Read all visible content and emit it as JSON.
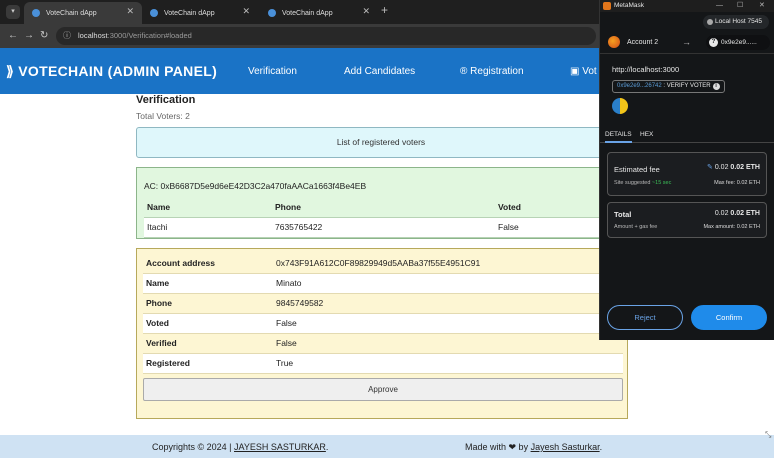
{
  "browser": {
    "tabs": [
      {
        "title": "VoteChain dApp",
        "active": true
      },
      {
        "title": "VoteChain dApp",
        "active": false
      },
      {
        "title": "VoteChain dApp",
        "active": false
      }
    ],
    "url_host": "localhost",
    "url_path": ":3000/Verification#loaded"
  },
  "app": {
    "brand": "VOTECHAIN (ADMIN PANEL)",
    "nav": [
      "Verification",
      "Add Candidates",
      "Registration",
      "Vot"
    ],
    "page_title": "Verification",
    "total_voters": "Total Voters: 2",
    "list_banner": "List of registered voters",
    "voter": {
      "ac_line": "AC: 0xB6687D5e9d6eE42D3C2a470faAACa1663f4Be4EB",
      "headers": [
        "Name",
        "Phone",
        "Voted"
      ],
      "row": [
        "Itachi",
        "7635765422",
        "False"
      ]
    },
    "detail": {
      "rows": [
        {
          "key": "Account address",
          "value": "0x743F91A612C0F89829949d5AABa37f55E4951C91"
        },
        {
          "key": "Name",
          "value": "Minato"
        },
        {
          "key": "Phone",
          "value": "9845749582"
        },
        {
          "key": "Voted",
          "value": "False"
        },
        {
          "key": "Verified",
          "value": "False"
        },
        {
          "key": "Registered",
          "value": "True"
        }
      ],
      "approve_label": "Approve"
    },
    "footer_left_prefix": "Copyrights © 2024 | ",
    "footer_left_name": "JAYESH SASTURKAR",
    "footer_left_suffix": ".",
    "footer_right_prefix": "Made with ❤ by ",
    "footer_right_name": "Jayesh Sasturkar",
    "footer_right_suffix": "."
  },
  "metamask": {
    "window_title": "MetaMask",
    "network": "Local Host 7545",
    "account_name": "Account 2",
    "to_address": "0x9e2e9......",
    "origin": "http://localhost:3000",
    "method_addr": "0x9e2e9...26742",
    "method_name": " : VERIFY VOTER",
    "tab_details": "DETAILS",
    "tab_hex": "HEX",
    "est_fee_label": "Estimated fee",
    "est_fee_value": "0.02",
    "est_fee_value_bold": "0.02 ETH",
    "site_suggested": "Site suggested",
    "site_time": " ~15 sec",
    "max_fee": "Max fee:  0.02 ETH",
    "total_label": "Total",
    "total_value": "0.02",
    "total_value_bold": "0.02 ETH",
    "amount_gas": "Amount + gas fee",
    "max_amount": "Max amount:  0.02 ETH",
    "reject_label": "Reject",
    "confirm_label": "Confirm"
  }
}
